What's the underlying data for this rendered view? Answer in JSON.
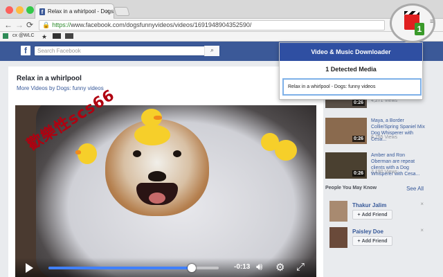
{
  "browser": {
    "tab_title": "Relax in a whirlpool - Dogs",
    "tab_close": "×",
    "url_prefix": "https://",
    "url_host": "www.facebook.com",
    "url_path": "/dogsfunnyvideos/videos/1691948904352590/",
    "bookmarks": [
      "cx @WLC"
    ],
    "traffic_colors": [
      "#fc605b",
      "#fdbc40",
      "#34c84a"
    ]
  },
  "facebook": {
    "logo": "f",
    "search_placeholder": "Search Facebook",
    "brand_color": "#3b5998"
  },
  "video": {
    "title": "Relax in a whirlpool",
    "more_videos": "More Videos by Dogs: funny videos",
    "time_remaining": "-0:13",
    "progress": 0.84
  },
  "watermark": "歡樂性scs66",
  "sidebar": {
    "videos": [
      {
        "title": "",
        "views": "4,271 Views",
        "duration": "0:26"
      },
      {
        "title": "Maya, a Border Collie/Spring Spaniel Mix Dog Whisperer with Cesa...",
        "views": "6,755 Views",
        "duration": "0:26"
      },
      {
        "title": "Amber and Ron Oberman are repeat clients with a Dog Whisperer with Cesa...",
        "views": "7,190 Views",
        "duration": "0:26"
      }
    ],
    "pymk_title": "People You May Know",
    "see_all": "See All",
    "people": [
      {
        "name": "Thakur Jalim",
        "button": "Add Friend"
      },
      {
        "name": "Paisley Doe",
        "button": "Add Friend"
      }
    ]
  },
  "extension_popup": {
    "title": "Video & Music Downloader",
    "detected": "1 Detected Media",
    "item": "Relax in a whirlpool - Dogs: funny videos",
    "badge": "1"
  }
}
